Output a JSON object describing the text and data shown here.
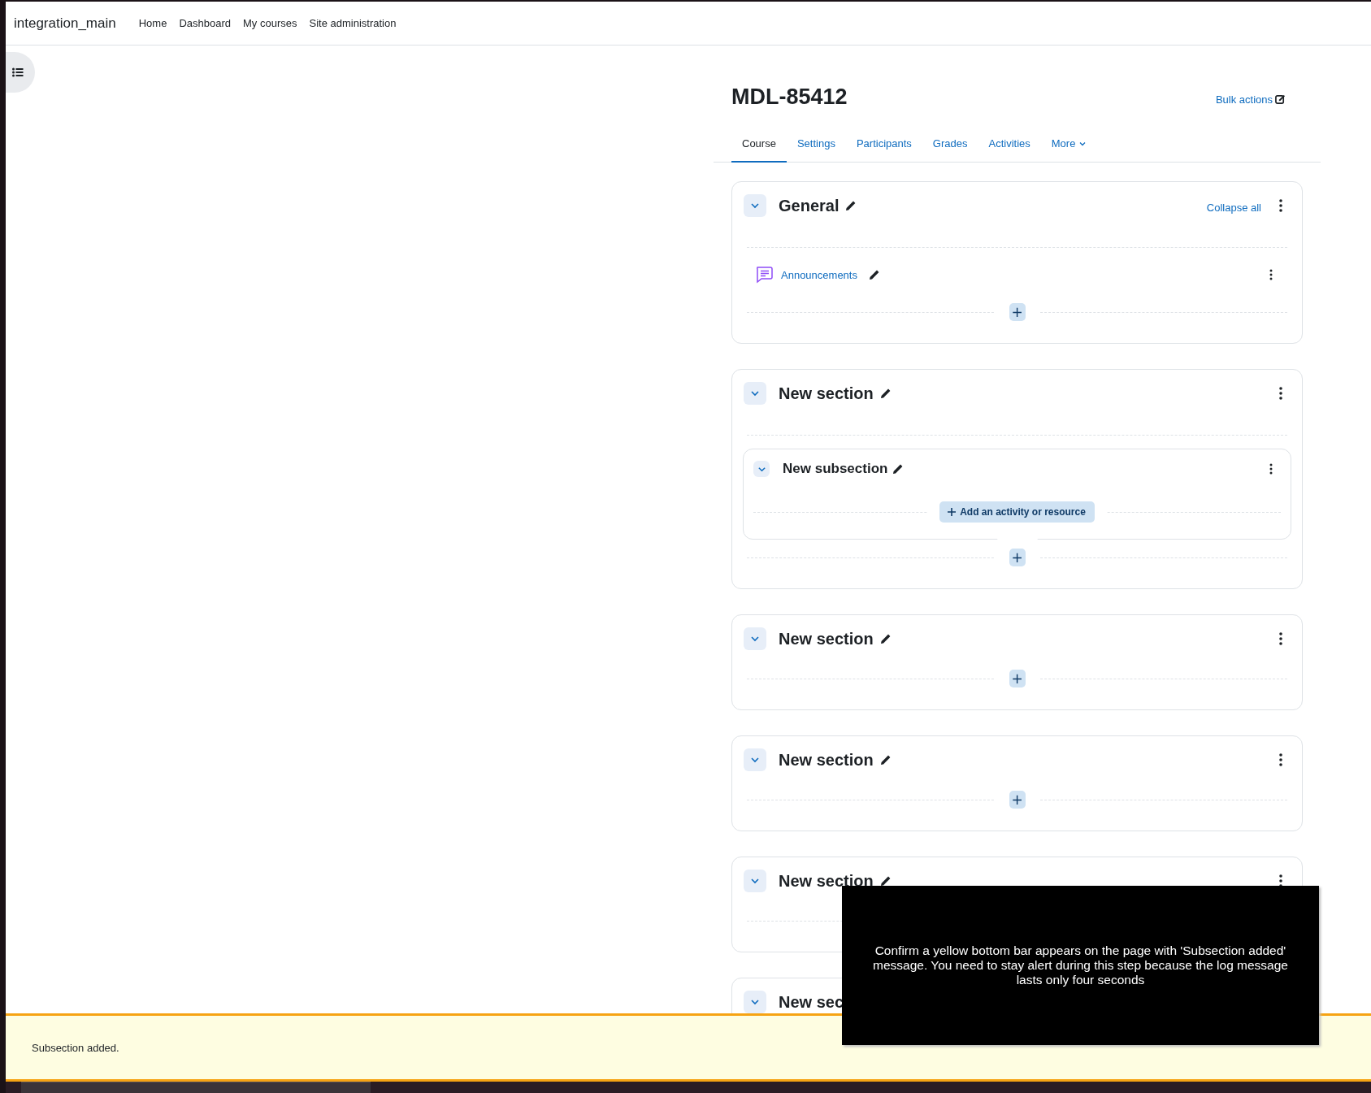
{
  "site": {
    "name": "integration_main"
  },
  "nav": [
    {
      "label": "Home"
    },
    {
      "label": "Dashboard"
    },
    {
      "label": "My courses"
    },
    {
      "label": "Site administration"
    }
  ],
  "course": {
    "title": "MDL-85412",
    "bulk_actions": "Bulk actions"
  },
  "tabs": [
    {
      "label": "Course",
      "selected": true,
      "kind": "link"
    },
    {
      "label": "Settings",
      "selected": false,
      "kind": "link"
    },
    {
      "label": "Participants",
      "selected": false,
      "kind": "link"
    },
    {
      "label": "Grades",
      "selected": false,
      "kind": "link"
    },
    {
      "label": "Activities",
      "selected": false,
      "kind": "link"
    },
    {
      "label": "More",
      "selected": false,
      "kind": "menu"
    }
  ],
  "collapse_all": "Collapse all",
  "sections": [
    {
      "title": "General",
      "expanded": true,
      "activities": [
        {
          "name": "Announcements",
          "kind": "forum"
        }
      ],
      "add_label": "+"
    },
    {
      "title": "New section",
      "expanded": true,
      "subsections": [
        {
          "title": "New subsection",
          "expanded": true,
          "add_activity": "Add an activity or resource"
        }
      ],
      "add_label": "+"
    },
    {
      "title": "New section",
      "expanded": true,
      "add_label": "+"
    },
    {
      "title": "New section",
      "expanded": true,
      "add_label": "+"
    },
    {
      "title": "New section",
      "expanded": true
    },
    {
      "title": "New sec",
      "expanded": true
    }
  ],
  "toast": {
    "message": "Subsection added."
  },
  "instruction_overlay": {
    "text": "Confirm a yellow bottom bar appears on the page with 'Subsection added' message. You need to stay alert during this step because the log message lasts only four seconds"
  }
}
